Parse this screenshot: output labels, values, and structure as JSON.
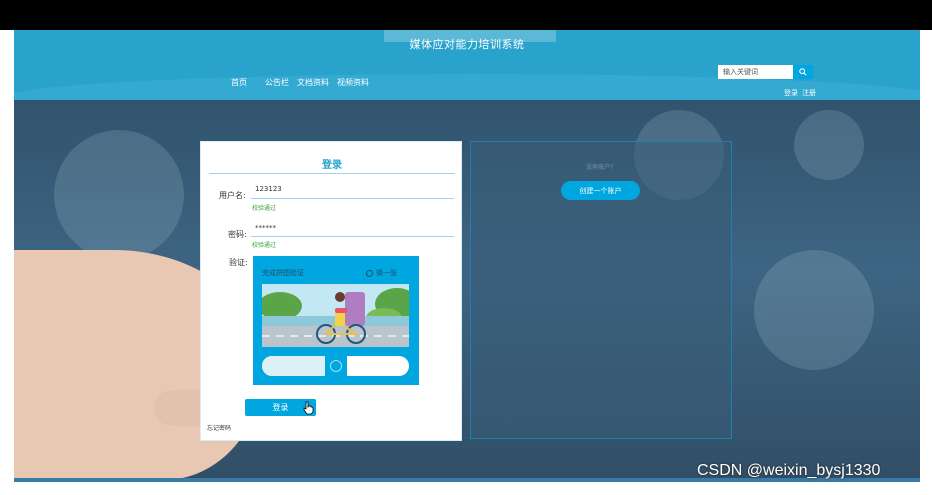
{
  "header": {
    "title": "媒体应对能力培训系统",
    "nav": [
      "首页",
      "公告栏",
      "文档资料",
      "视频资料"
    ],
    "search": {
      "placeholder": "输入关键词",
      "icon": "search-icon"
    },
    "auth": {
      "login": "登录",
      "register": "注册"
    }
  },
  "login_form": {
    "title": "登录",
    "username": {
      "label": "用户名:",
      "value": "123123",
      "status": "校验通过"
    },
    "password": {
      "label": "密码:",
      "value": "******",
      "status": "校验通过"
    },
    "captcha": {
      "label": "验证:",
      "instruction": "完成拼图验证",
      "refresh_label": "换一张",
      "slider_progress": 0.5
    },
    "submit_label": "登录",
    "forgot_label": "忘记密码"
  },
  "register": {
    "prompt": "没有账户?",
    "create_label": "创建一个账户"
  },
  "watermark": "CSDN @weixin_bysj1330",
  "colors": {
    "primary": "#2aa3cc",
    "button": "#00a6df",
    "success": "#3aa33a"
  }
}
